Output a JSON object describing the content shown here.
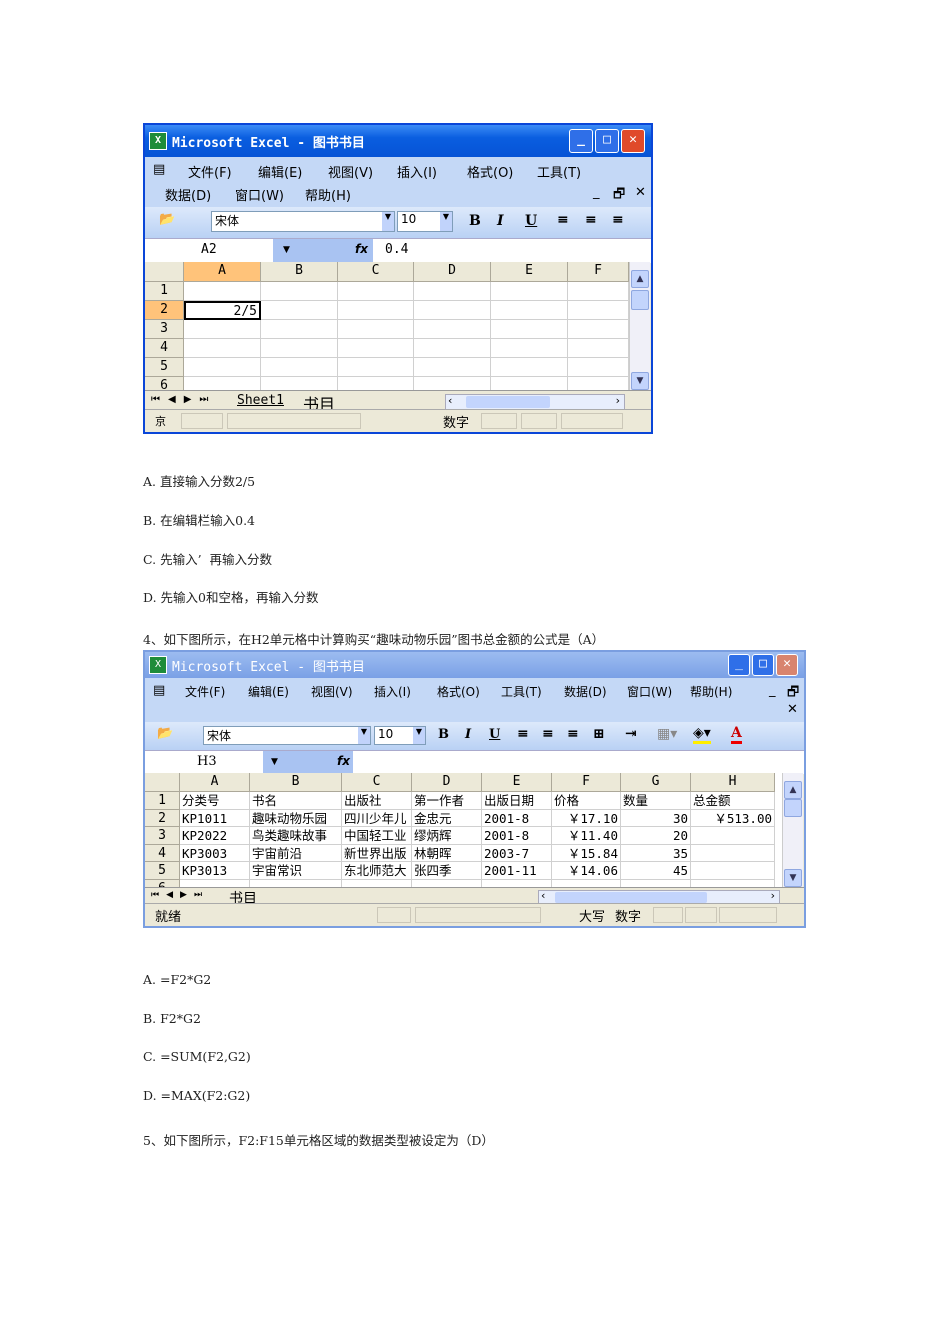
{
  "window1": {
    "title": "Microsoft Excel - 图书书目",
    "menu": [
      "文件(F)",
      "编辑(E)",
      "视图(V)",
      "插入(I)",
      "格式(O)",
      "工具(T)",
      "数据(D)",
      "窗口(W)",
      "帮助(H)"
    ],
    "font": "宋体",
    "size": "10",
    "bold": "B",
    "italic": "I",
    "underline": "U",
    "name_box": "A2",
    "fx": "fx",
    "formula": "0.4",
    "columns": [
      "A",
      "B",
      "C",
      "D",
      "E",
      "F"
    ],
    "rows": [
      "1",
      "2",
      "3",
      "4",
      "5",
      "6"
    ],
    "cells": {
      "A2": "2/5"
    },
    "tabs": [
      "Sheet1",
      "书目"
    ],
    "status": "就绪",
    "status_num": "数字"
  },
  "window2": {
    "title": "Microsoft Excel - 图书书目",
    "menu": [
      "文件(F)",
      "编辑(E)",
      "视图(V)",
      "插入(I)",
      "格式(O)",
      "工具(T)",
      "数据(D)",
      "窗口(W)",
      "帮助(H)"
    ],
    "font": "宋体",
    "size": "10",
    "bold": "B",
    "italic": "I",
    "underline": "U",
    "name_box": "H3",
    "fx": "fx",
    "formula": "",
    "columns": [
      "A",
      "B",
      "C",
      "D",
      "E",
      "F",
      "G",
      "H"
    ],
    "rows": [
      "1",
      "2",
      "3",
      "4",
      "5",
      "6"
    ],
    "table": [
      [
        "分类号",
        "书名",
        "出版社",
        "第一作者",
        "出版日期",
        "价格",
        "数量",
        "总金额"
      ],
      [
        "KP1011",
        "趣味动物乐园",
        "四川少年儿",
        "金忠元",
        "2001-8",
        "￥17.10",
        "30",
        "￥513.00"
      ],
      [
        "KP2022",
        "鸟类趣味故事",
        "中国轻工业",
        "缪炳辉",
        "2001-8",
        "￥11.40",
        "20",
        ""
      ],
      [
        "KP3003",
        "宇宙前沿",
        "新世界出版",
        "林朝晖",
        "2003-7",
        "￥15.84",
        "35",
        ""
      ],
      [
        "KP3013",
        "宇宙常识",
        "东北师范大",
        "张四季",
        "2001-11",
        "￥14.06",
        "45",
        ""
      ]
    ],
    "tabs": [
      "书目"
    ],
    "status": "就绪",
    "status_caps": "大写",
    "status_num": "数字"
  },
  "q3_options": [
    "A. 直接输入分数2/5",
    "B. 在编辑栏输入0.4",
    "C. 先输入’  再输入分数",
    "D. 先输入0和空格，再输入分数"
  ],
  "q4": "4、如下图所示，在H2单元格中计算购买“趣味动物乐园”图书总金额的公式是（A）",
  "q4_options": [
    "A. =F2*G2",
    "B. F2*G2",
    "C. =SUM(F2,G2)",
    "D. =MAX(F2:G2)"
  ],
  "q5": "5、如下图所示，F2:F15单元格区域的数据类型被设定为（D）"
}
